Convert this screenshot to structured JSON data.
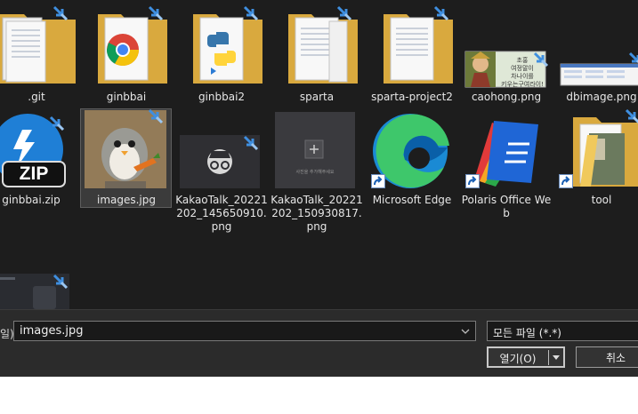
{
  "files": [
    {
      "label": ".git",
      "kind": "folder"
    },
    {
      "label": "ginbbai",
      "kind": "folder-chrome"
    },
    {
      "label": "ginbbai2",
      "kind": "folder-python"
    },
    {
      "label": "sparta",
      "kind": "folder"
    },
    {
      "label": "sparta-project2",
      "kind": "folder"
    },
    {
      "label": "caohong.png",
      "kind": "image",
      "inner_text": [
        "초홍",
        "여정말이",
        "차나이를",
        "키우는구여라이!"
      ]
    },
    {
      "label": "dbimage.png",
      "kind": "image"
    },
    {
      "label": "ginbbai.zip",
      "kind": "zip",
      "badge": "ZIP"
    },
    {
      "label": "images.jpg",
      "kind": "image",
      "selected": true
    },
    {
      "label": "KakaoTalk_20221202_145650910.png",
      "kind": "image"
    },
    {
      "label": "KakaoTalk_20221202_150930817.png",
      "kind": "image",
      "inner_text": [
        "사진을 추가해주세요"
      ]
    },
    {
      "label": "Microsoft Edge",
      "kind": "shortcut-edge"
    },
    {
      "label": "Polaris Office Web",
      "kind": "shortcut-polaris"
    },
    {
      "label": "tool",
      "kind": "shortcut-folder"
    },
    {
      "label": "",
      "kind": "image-partial"
    }
  ],
  "bottom": {
    "filename_label": "일):",
    "filename_value": "images.jpg",
    "filetype_value": "모든 파일 (*.*)",
    "open_label": "열기(O)",
    "cancel_label": "취소"
  },
  "colors": {
    "background": "#1d1d1d",
    "folder": "#f3c969",
    "sync_arrow": "#3f8fe0",
    "edge_blue": "#1a8ad4",
    "edge_green": "#3ec76b"
  }
}
